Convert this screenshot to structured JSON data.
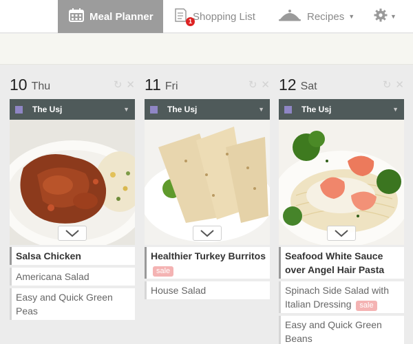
{
  "nav": {
    "meal_planner": "Meal Planner",
    "shopping_list": "Shopping List",
    "shopping_badge": "1",
    "recipes": "Recipes"
  },
  "days": [
    {
      "number": "10",
      "name": "Thu",
      "plan": "The Usj",
      "main": "Salsa Chicken",
      "main_sale": "",
      "sides": [
        {
          "label": "Americana Salad",
          "sale": ""
        },
        {
          "label": "Easy and Quick Green Peas",
          "sale": ""
        }
      ]
    },
    {
      "number": "11",
      "name": "Fri",
      "plan": "The Usj",
      "main": "Healthier Turkey Burritos",
      "main_sale": "sale",
      "sides": [
        {
          "label": "House Salad",
          "sale": ""
        }
      ]
    },
    {
      "number": "12",
      "name": "Sat",
      "plan": "The Usj",
      "main": "Seafood White Sauce over Angel Hair Pasta",
      "main_sale": "",
      "sides": [
        {
          "label": "Spinach Side Salad with Italian Dressing",
          "sale": "sale"
        },
        {
          "label": "Easy and Quick Green Beans",
          "sale": ""
        }
      ]
    }
  ],
  "icons": {
    "calendar": "calendar-icon",
    "shopping_list": "shopping-list-icon",
    "recipes": "cloche-icon",
    "settings": "gear-icon",
    "refresh": "refresh-icon",
    "close": "close-icon",
    "expand": "chevron-down-icon"
  },
  "colors": {
    "active_tab": "#9c9c9c",
    "plan_bar": "#4f5a5a",
    "plan_square": "#8f86c5",
    "sale_badge": "#f4b3b3",
    "notification": "#dd2222"
  }
}
